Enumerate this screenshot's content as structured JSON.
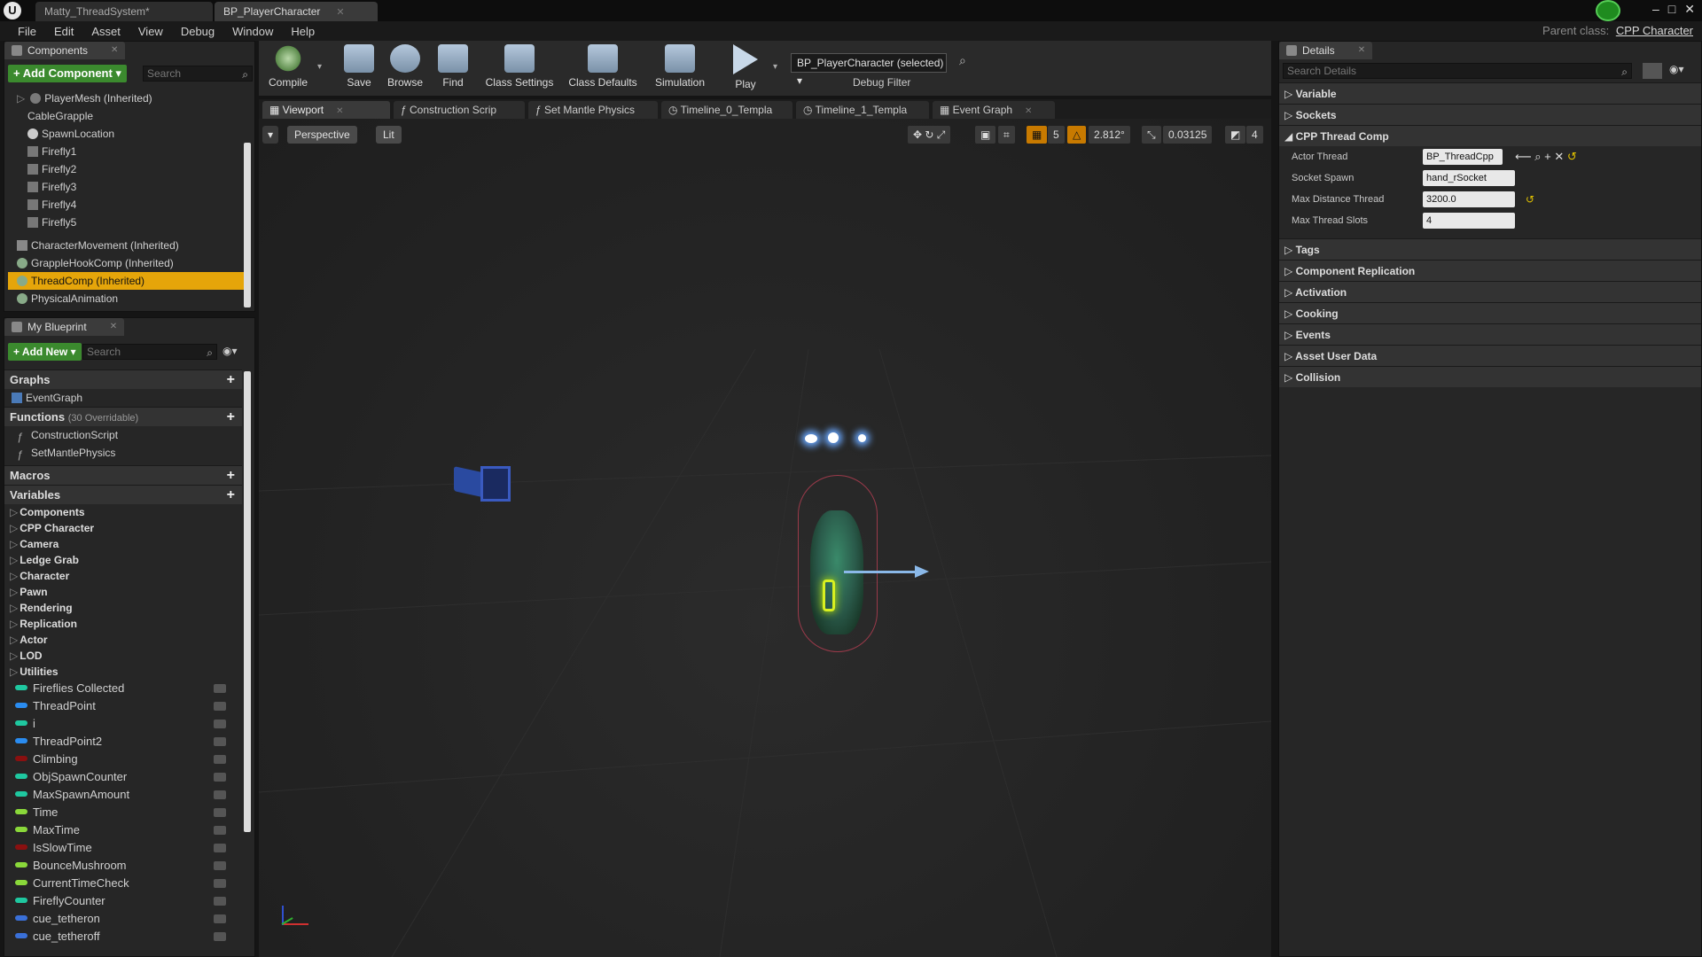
{
  "title_tabs": [
    {
      "label": "Matty_ThreadSystem*"
    },
    {
      "label": "BP_PlayerCharacter"
    }
  ],
  "menu": [
    "File",
    "Edit",
    "Asset",
    "View",
    "Debug",
    "Window",
    "Help"
  ],
  "parent_class": {
    "label": "Parent class:",
    "value": "CPP Character"
  },
  "components_panel": {
    "tab": "Components",
    "add_button": "+ Add Component ▾",
    "search_placeholder": "Search",
    "items": [
      "PlayerMesh (Inherited)",
      "CableGrapple",
      "SpawnLocation",
      "Firefly1",
      "Firefly2",
      "Firefly3",
      "Firefly4",
      "Firefly5",
      "CharacterMovement (Inherited)",
      "GrappleHookComp (Inherited)",
      "ThreadComp (Inherited)",
      "PhysicalAnimation"
    ],
    "selected_index": 10
  },
  "my_blueprint": {
    "tab": "My Blueprint",
    "add_button": "+ Add New ▾",
    "search_placeholder": "Search",
    "sections": {
      "graphs": "Graphs",
      "graphs_items": [
        "EventGraph"
      ],
      "functions": "Functions",
      "functions_note": "(30 Overridable)",
      "functions_items": [
        "ConstructionScript",
        "SetMantlePhysics"
      ],
      "macros": "Macros",
      "variables": "Variables"
    },
    "categories": [
      "Components",
      "CPP Character",
      "Camera",
      "Ledge Grab",
      "Character",
      "Pawn",
      "Rendering",
      "Replication",
      "Actor",
      "LOD",
      "Utilities"
    ],
    "variables": [
      {
        "name": "Fireflies Collected",
        "color": "#1fc8a0"
      },
      {
        "name": "ThreadPoint",
        "color": "#2a8cf0"
      },
      {
        "name": "i",
        "color": "#1fc8a0"
      },
      {
        "name": "ThreadPoint2",
        "color": "#2a8cf0"
      },
      {
        "name": "Climbing",
        "color": "#8a1010"
      },
      {
        "name": "ObjSpawnCounter",
        "color": "#1fc8a0"
      },
      {
        "name": "MaxSpawnAmount",
        "color": "#1fc8a0"
      },
      {
        "name": "Time",
        "color": "#8ad83a"
      },
      {
        "name": "MaxTime",
        "color": "#8ad83a"
      },
      {
        "name": "IsSlowTime",
        "color": "#8a1010"
      },
      {
        "name": "BounceMushroom",
        "color": "#8ad83a"
      },
      {
        "name": "CurrentTimeCheck",
        "color": "#8ad83a"
      },
      {
        "name": "FireflyCounter",
        "color": "#1fc8a0"
      },
      {
        "name": "cue_tetheron",
        "color": "#3a70d8"
      },
      {
        "name": "cue_tetheroff",
        "color": "#3a70d8"
      }
    ]
  },
  "toolbar": {
    "compile": "Compile",
    "save": "Save",
    "browse": "Browse",
    "find": "Find",
    "class_settings": "Class Settings",
    "class_defaults": "Class Defaults",
    "simulation": "Simulation",
    "play": "Play",
    "debug_select": "BP_PlayerCharacter (selected) ▾",
    "debug_filter": "Debug Filter"
  },
  "editor_tabs": [
    "Viewport",
    "Construction Scrip",
    "Set Mantle Physics",
    "Timeline_0_Templa",
    "Timeline_1_Templa",
    "Event Graph"
  ],
  "viewport": {
    "perspective": "Perspective",
    "lit": "Lit",
    "grid_snap": "5",
    "rot_snap": "2.812°",
    "scale_snap": "0.03125",
    "cam_speed": "4"
  },
  "details": {
    "tab": "Details",
    "search_placeholder": "Search Details",
    "sections_top": [
      "Variable",
      "Sockets"
    ],
    "cpp_thread": "CPP Thread Comp",
    "props": [
      {
        "label": "Actor Thread",
        "value": "BP_ThreadCpp ▾"
      },
      {
        "label": "Socket Spawn",
        "value": "hand_rSocket"
      },
      {
        "label": "Max Distance Thread",
        "value": "3200.0"
      },
      {
        "label": "Max Thread Slots",
        "value": "4"
      }
    ],
    "sections_bottom": [
      "Tags",
      "Component Replication",
      "Activation",
      "Cooking",
      "Events",
      "Asset User Data",
      "Collision"
    ]
  }
}
